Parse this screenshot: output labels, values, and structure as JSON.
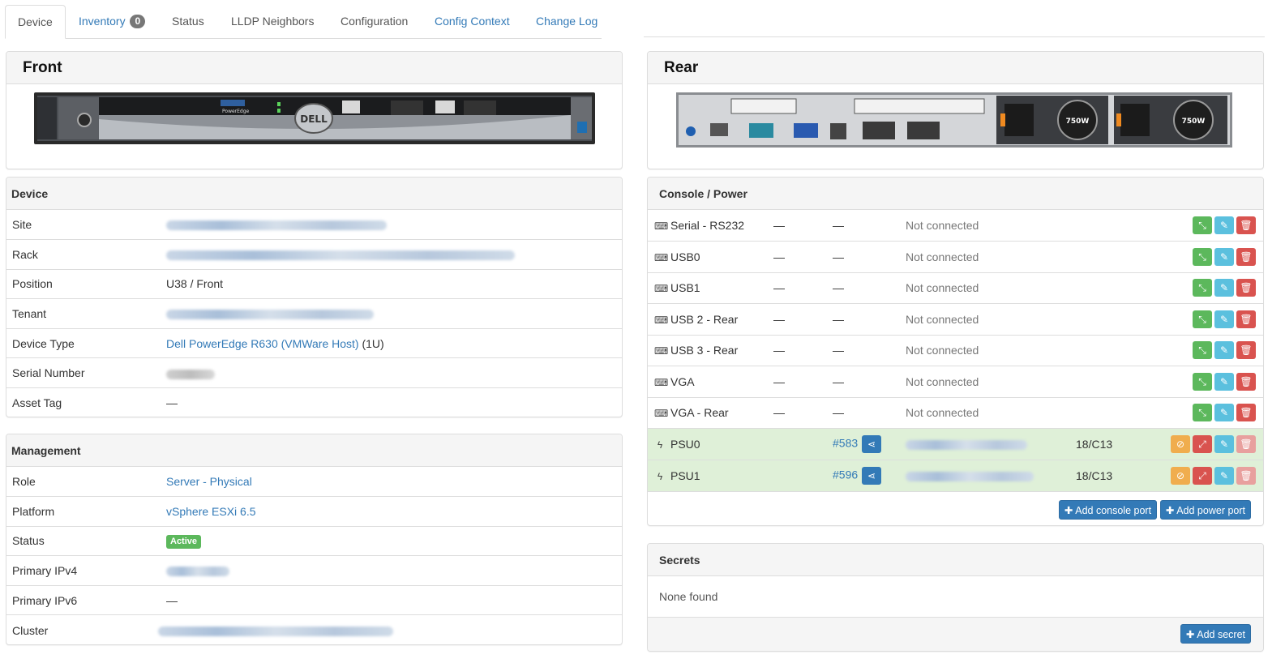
{
  "tabs": [
    {
      "label": "Device"
    },
    {
      "label": "Inventory",
      "count": "0"
    },
    {
      "label": "Status"
    },
    {
      "label": "LLDP Neighbors"
    },
    {
      "label": "Configuration"
    },
    {
      "label": "Config Context"
    },
    {
      "label": "Change Log"
    }
  ],
  "front": {
    "title": "Front",
    "brand": "DELL",
    "model_text": "PowerEdge"
  },
  "rear": {
    "title": "Rear",
    "psu_label": "750W"
  },
  "device_panel": {
    "title": "Device",
    "rows": [
      {
        "key": "Site",
        "value": ""
      },
      {
        "key": "Rack",
        "value": ""
      },
      {
        "key": "Position",
        "value": "U38 / Front"
      },
      {
        "key": "Tenant",
        "value": ""
      },
      {
        "key": "Device Type",
        "link": "Dell PowerEdge R630 (VMWare Host)",
        "suffix": "(1U)"
      },
      {
        "key": "Serial Number",
        "value": ""
      },
      {
        "key": "Asset Tag",
        "value": "—"
      }
    ]
  },
  "management_panel": {
    "title": "Management",
    "rows": [
      {
        "key": "Role",
        "link": "Server - Physical"
      },
      {
        "key": "Platform",
        "link": "vSphere ESXi 6.5"
      },
      {
        "key": "Status",
        "badge": "Active"
      },
      {
        "key": "Primary IPv4",
        "value": ""
      },
      {
        "key": "Primary IPv6",
        "value": "—"
      },
      {
        "key": "Cluster",
        "value": ""
      }
    ]
  },
  "console_power": {
    "title": "Console / Power",
    "console_ports": [
      {
        "name": "Serial - RS232",
        "col1": "—",
        "col2": "—",
        "status": "Not connected"
      },
      {
        "name": "USB0",
        "col1": "—",
        "col2": "—",
        "status": "Not connected"
      },
      {
        "name": "USB1",
        "col1": "—",
        "col2": "—",
        "status": "Not connected"
      },
      {
        "name": "USB 2 - Rear",
        "col1": "—",
        "col2": "—",
        "status": "Not connected"
      },
      {
        "name": "USB 3 - Rear",
        "col1": "—",
        "col2": "—",
        "status": "Not connected"
      },
      {
        "name": "VGA",
        "col1": "—",
        "col2": "—",
        "status": "Not connected"
      },
      {
        "name": "VGA - Rear",
        "col1": "—",
        "col2": "—",
        "status": "Not connected"
      }
    ],
    "power_ports": [
      {
        "name": "PSU0",
        "cable": "#583",
        "outlet": "18/C13"
      },
      {
        "name": "PSU1",
        "cable": "#596",
        "outlet": "18/C13"
      }
    ],
    "add_console_label": "Add console port",
    "add_power_label": "Add power port"
  },
  "secrets": {
    "title": "Secrets",
    "empty_text": "None found",
    "add_label": "Add secret"
  },
  "colors": {
    "link": "#337ab7",
    "success_row": "#dff0d8",
    "btn_green": "#5cb85c",
    "btn_info": "#5bc0de",
    "btn_danger": "#d9534f",
    "btn_warning": "#f0ad4e",
    "badge_active": "#5cb85c"
  }
}
